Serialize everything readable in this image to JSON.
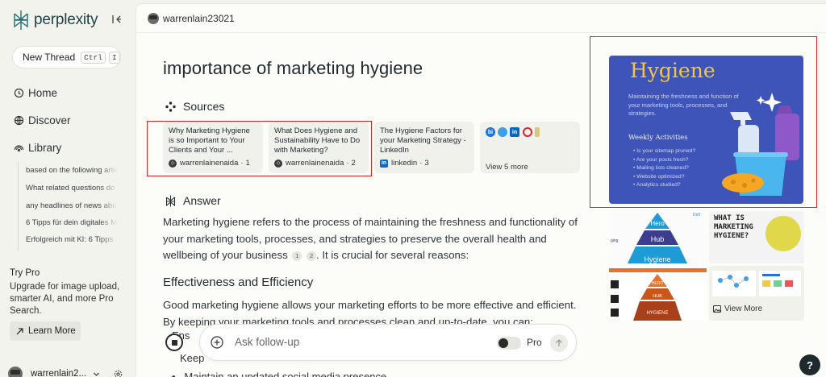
{
  "sidebar": {
    "logo_text": "perplexity",
    "new_thread": {
      "label": "New Thread",
      "kbd1": "Ctrl",
      "kbd2": "I"
    },
    "nav": [
      {
        "label": "Home",
        "icon": "home-icon"
      },
      {
        "label": "Discover",
        "icon": "globe-icon"
      },
      {
        "label": "Library",
        "icon": "library-icon"
      }
    ],
    "library_items": [
      "based on the following article",
      "What related questions do",
      "any headlines of news about",
      "6 Tipps für dein digitales Marketing",
      "Erfolgreich mit KI: 6 Tipps"
    ],
    "try_pro": {
      "title": "Try Pro",
      "desc": "Upgrade for image upload, smarter AI, and more Pro Search.",
      "cta": "Learn More"
    },
    "user": {
      "name": "warrenlain2..."
    }
  },
  "topbar": {
    "username": "warrenlain23021"
  },
  "main": {
    "query": "importance of marketing hygiene",
    "sources_heading": "Sources",
    "sources": [
      {
        "title": "Why Marketing Hygiene is so Important to Your Clients and Your ...",
        "site": "warrenlainenaida",
        "num": "1"
      },
      {
        "title": "What Does Hygiene and Sustainability Have to Do with Marketing?",
        "site": "warrenlainenaida",
        "num": "2"
      },
      {
        "title": "The Hygiene Factors for your Marketing Strategy - LinkedIn",
        "site": "linkedin",
        "num": "3"
      }
    ],
    "view_more_sources": "View 5 more",
    "answer_heading": "Answer",
    "answer_p1": "Marketing hygiene refers to the process of maintaining the freshness and functionality of your marketing tools, processes, and strategies to preserve the overall health and wellbeing of your business",
    "answer_p1_cites": [
      "1",
      "2"
    ],
    "answer_p1_tail": ". It is crucial for several reasons:",
    "section_heading": "Effectiveness and Efficiency",
    "answer_p2": "Good marketing hygiene allows your marketing efforts to be more effective and efficient. By keeping your marketing tools and processes clean and up-to-date, you can:",
    "bullet_partial_1": "Ens",
    "bullet_partial_2": "Keep",
    "bullet_partial_3": "Maintain an updated social media presence"
  },
  "followup": {
    "placeholder": "Ask follow-up",
    "pro_label": "Pro",
    "pro_enabled": false
  },
  "images": {
    "hero": {
      "title": "Hygiene",
      "desc": "Maintaining the freshness and function of your marketing tools, processes, and strategies.",
      "weekly": "Weekly Activities",
      "items": [
        "Is your sitemap pruned?",
        "Are your posts fresh?",
        "Mailing lists cleaned?",
        "Website optimized?",
        "Analytics studied?"
      ]
    },
    "pyramid": {
      "top": "Hero",
      "mid": "Hub",
      "bottom": "Hygiene"
    },
    "whatis": {
      "line1": "WHAT IS",
      "line2": "MARKETING",
      "line3": "HYGIENE?"
    },
    "relationship": {
      "top": "HERO",
      "mid": "HUB",
      "bottom": "HYGIENE"
    },
    "view_more": "View More"
  },
  "help_label": "?"
}
